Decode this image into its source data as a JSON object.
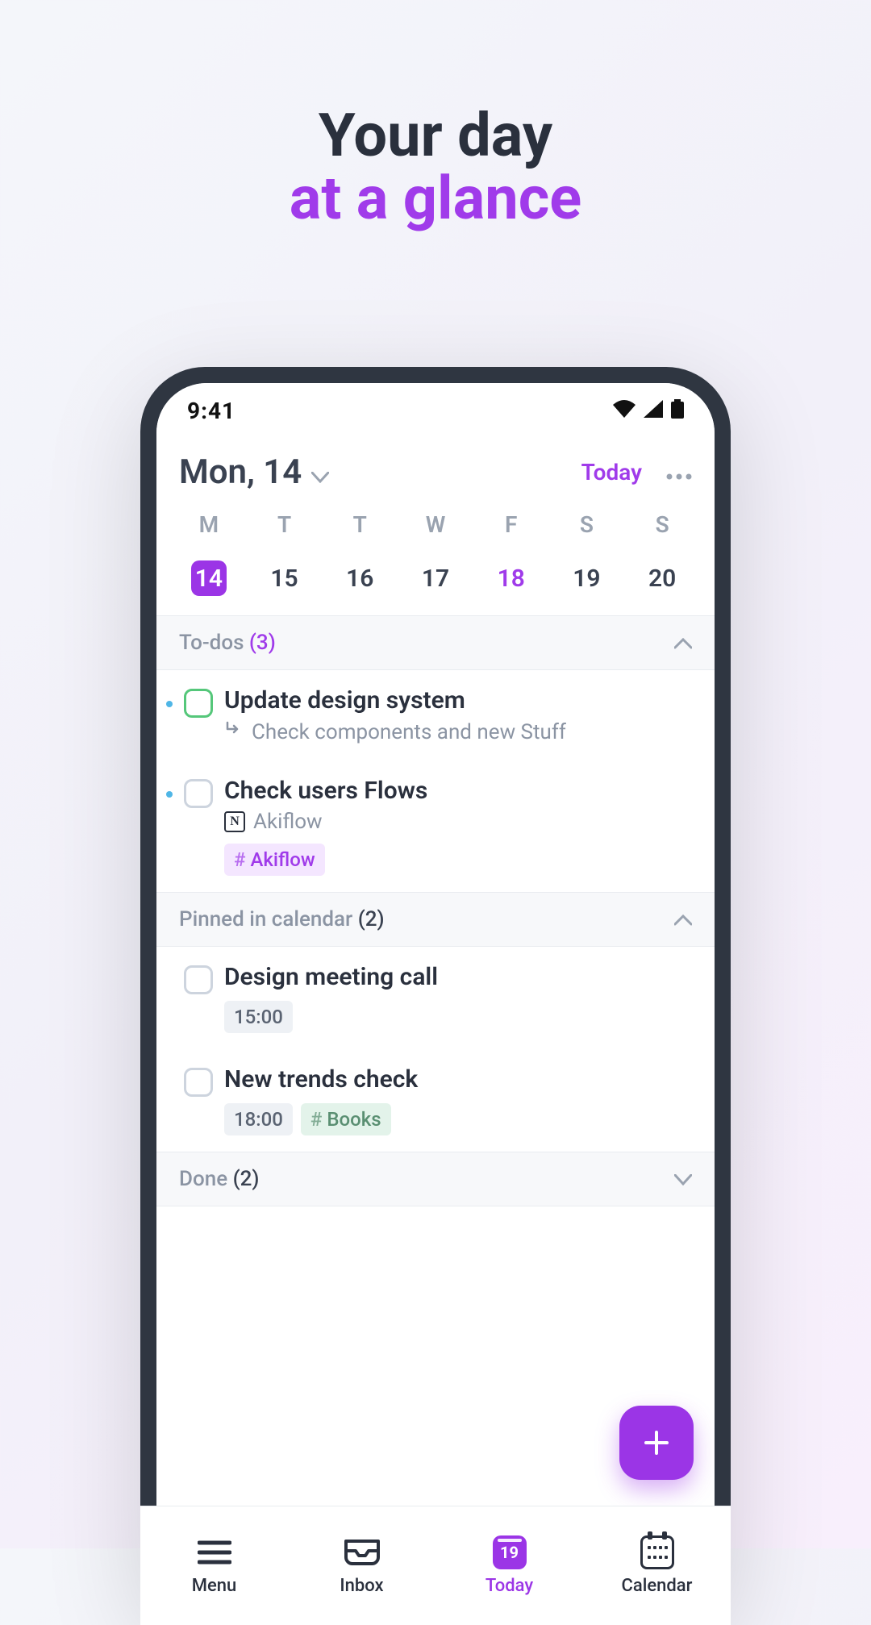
{
  "hero": {
    "line1": "Your day",
    "line2": "at a glance"
  },
  "statusbar": {
    "time": "9:41"
  },
  "header": {
    "date_label": "Mon, 14",
    "today_label": "Today"
  },
  "week": {
    "dow": [
      "M",
      "T",
      "T",
      "W",
      "F",
      "S",
      "S"
    ],
    "days": [
      "14",
      "15",
      "16",
      "17",
      "18",
      "19",
      "20"
    ],
    "selected_index": 0,
    "highlight_index": 4
  },
  "sections": {
    "todos": {
      "title": "To-dos",
      "count": "(3)"
    },
    "pinned": {
      "title": "Pinned in calendar",
      "count": "(2)"
    },
    "done": {
      "title": "Done",
      "count": "(2)"
    }
  },
  "todos": [
    {
      "title": "Update design system",
      "subtext": "Check components and new Stuff",
      "sub_icon": "enter-arrow",
      "check_style": "green",
      "has_dot": true,
      "tags": []
    },
    {
      "title": "Check users Flows",
      "subtext": "Akiflow",
      "sub_icon": "notion",
      "check_style": "default",
      "has_dot": true,
      "tags": [
        {
          "label": "Akiflow",
          "style": "purple"
        }
      ]
    }
  ],
  "pinned": [
    {
      "title": "Design meeting call",
      "time": "15:00",
      "tags": []
    },
    {
      "title": "New trends check",
      "time": "18:00",
      "tags": [
        {
          "label": "Books",
          "style": "mint"
        }
      ]
    }
  ],
  "fab": {
    "label": "+"
  },
  "nav": {
    "items": [
      {
        "label": "Menu",
        "icon": "menu"
      },
      {
        "label": "Inbox",
        "icon": "inbox"
      },
      {
        "label": "Today",
        "icon": "today",
        "badge": "19",
        "active": true
      },
      {
        "label": "Calendar",
        "icon": "calendar"
      }
    ]
  },
  "colors": {
    "accent": "#9b35e6"
  }
}
